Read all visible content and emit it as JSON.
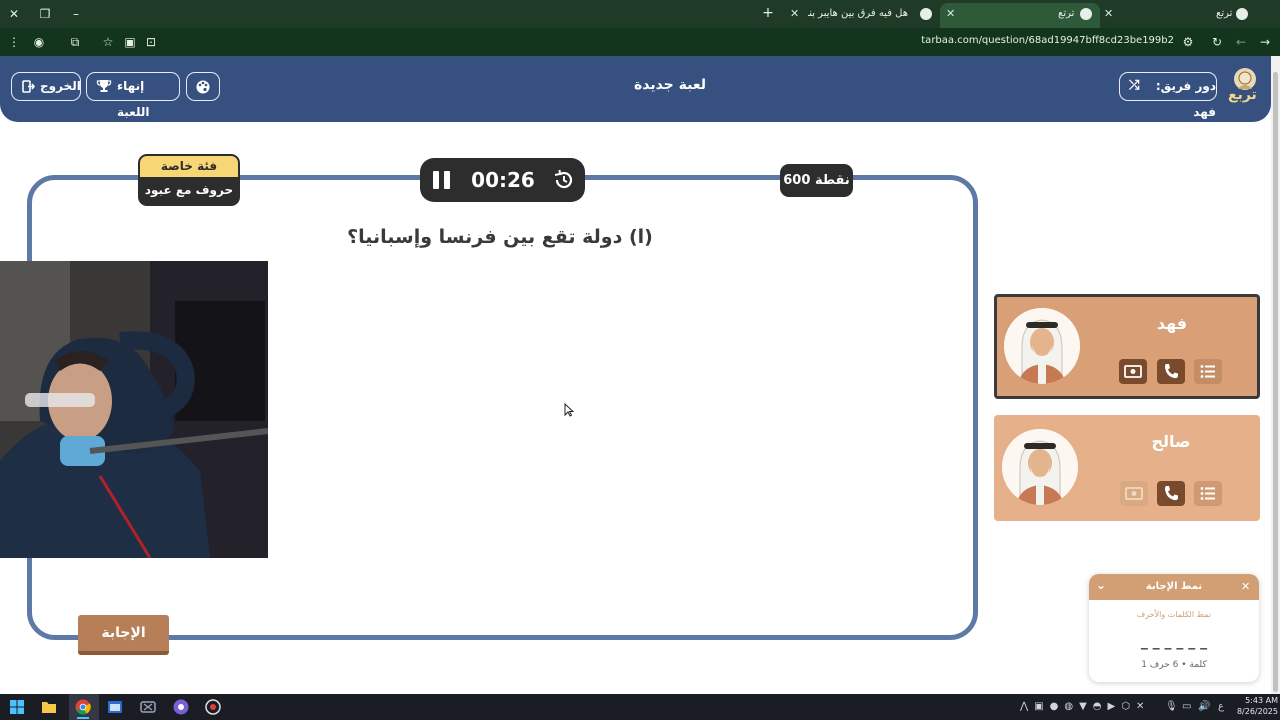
{
  "browser": {
    "tabs": [
      {
        "title": "ترتع",
        "active": false
      },
      {
        "title": "ترتع",
        "active": true
      },
      {
        "title": "هل فيه فرق بين هايبر بنده وبنده",
        "active": false
      }
    ],
    "new_tab_label": "+",
    "url": "tarbaa.com/question/68ad19947bff8cd23be199b2"
  },
  "header": {
    "logo_text": "تربع",
    "team_turn_label": "دور فريق: فهد",
    "game_title": "لعبة جديدة",
    "end_game_label": "إنهاء اللعبة",
    "exit_label": "الخروج"
  },
  "board": {
    "points": "600 نقطة",
    "timer": "00:26",
    "category_tag": "فئة خاصة",
    "category_name": "حروف مع عبود",
    "question": "(ا) دولة تقع بين فرنسا وإسبانيا؟",
    "answer_button": "الإجابة"
  },
  "teams": [
    {
      "name": "فهد",
      "active": true
    },
    {
      "name": "صالح",
      "active": false
    }
  ],
  "answer_pattern": {
    "title": "نمط الإجابة",
    "subtitle": "نمط الكلمات والأحرف",
    "pattern": "_ _ _ _ _ _",
    "summary": "كلمة • 6 حرف 1"
  },
  "taskbar": {
    "time": "5:43 AM",
    "date": "8/26/2025",
    "lang": "ع"
  },
  "colors": {
    "header_blue": "#36507f",
    "board_border": "#5f79a6",
    "card_tan": "#d9a077",
    "answer_brown": "#b77f58",
    "category_yellow": "#f6d675"
  }
}
